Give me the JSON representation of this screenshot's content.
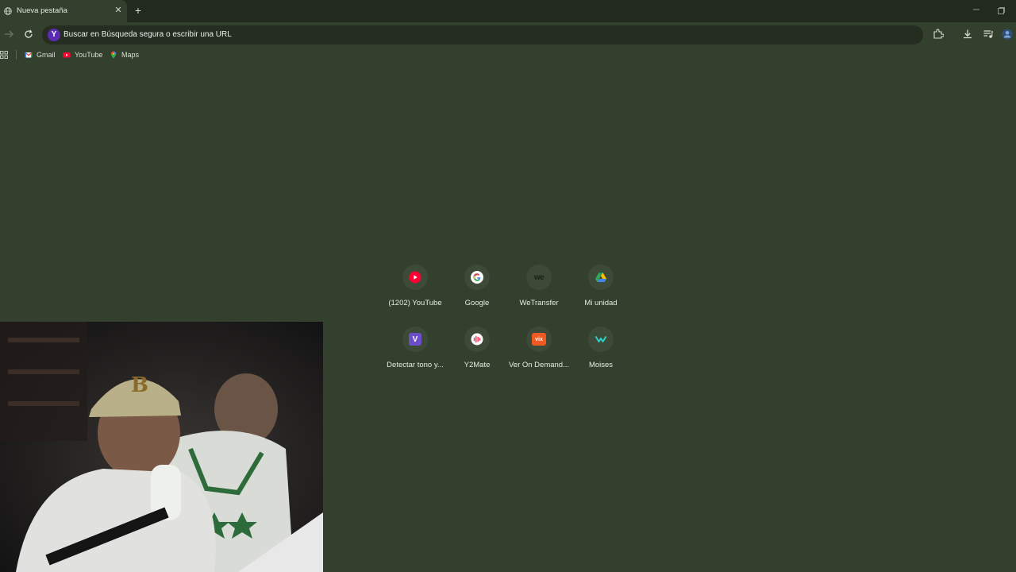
{
  "tab": {
    "title": "Nueva pestaña",
    "close_icon": "close-icon",
    "favicon": "globe-icon"
  },
  "newtab_icon": "plus-icon",
  "omnibox": {
    "text": "Buscar en Búsqueda segura o escribir una URL",
    "engine_letter": "Y"
  },
  "bookmarks": [
    {
      "label": "Gmail",
      "icon": "gmail-icon"
    },
    {
      "label": "YouTube",
      "icon": "youtube-icon"
    },
    {
      "label": "Maps",
      "icon": "maps-icon"
    }
  ],
  "shortcuts": [
    {
      "label": "(1202) YouTube",
      "icon": "youtube-icon",
      "color": "#ff0033"
    },
    {
      "label": "Google",
      "icon": "google-icon",
      "color": "#ffffff"
    },
    {
      "label": "WeTransfer",
      "icon": "wetransfer-icon",
      "text": "we",
      "color": "#3e4a38"
    },
    {
      "label": "Mi unidad",
      "icon": "google-drive-icon",
      "color": "#34a853"
    },
    {
      "label": "Detectar tono y...",
      "icon": "vocalremover-icon",
      "text": "V",
      "color": "#6a4fc8"
    },
    {
      "label": "Y2Mate",
      "icon": "y2mate-icon",
      "color": "#ff3355"
    },
    {
      "label": "Ver On Demand...",
      "icon": "vix-icon",
      "text": "vix",
      "color": "#f05a22"
    },
    {
      "label": "Moises",
      "icon": "moises-icon",
      "color": "#2ad0c8"
    }
  ]
}
